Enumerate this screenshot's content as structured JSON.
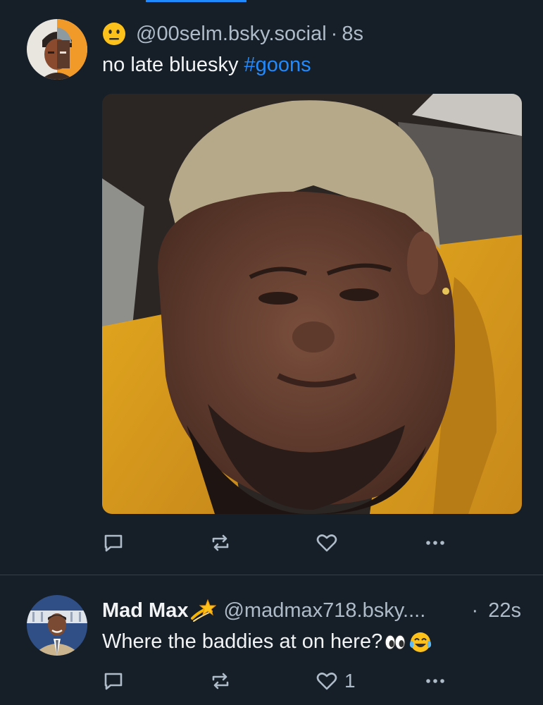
{
  "feed": {
    "active_tab_color": "#208bfe",
    "posts": [
      {
        "author_emoji": "neutral-face-emoji",
        "handle": "@00selm.bsky.social",
        "separator": "·",
        "time": "8s",
        "text": "no late bluesky",
        "hashtag": "#goons",
        "media": "photo of a man in a yellow hoodie",
        "actions": {
          "reply_count": "",
          "repost_count": "",
          "like_count": ""
        }
      },
      {
        "display_name": "Mad Max",
        "name_emoji": "dizzy-star-emoji",
        "handle": "@madmax718.bsky....",
        "separator": "·",
        "time": "22s",
        "text": "Where the baddies at on here?",
        "text_emojis": [
          "eyes-emoji",
          "tears-of-joy-emoji"
        ],
        "actions": {
          "reply_count": "",
          "repost_count": "",
          "like_count": "1"
        }
      }
    ]
  },
  "colors": {
    "background": "#161e27",
    "text": "#f1f3f5",
    "muted": "#aebbc9",
    "link": "#208bfe",
    "divider": "#2e4052"
  }
}
